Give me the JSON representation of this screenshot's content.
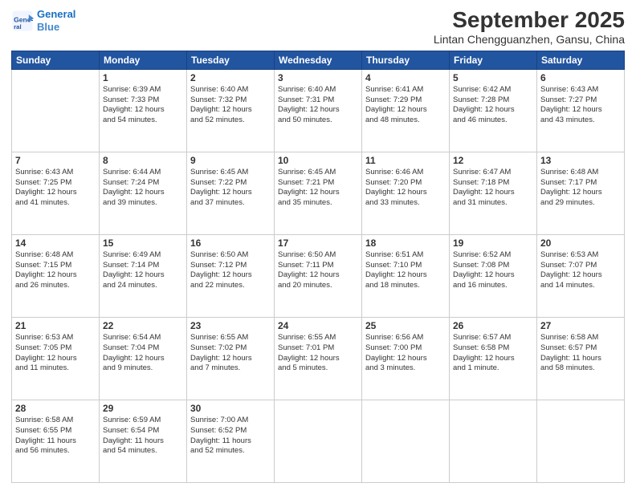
{
  "header": {
    "logo_line1": "General",
    "logo_line2": "Blue",
    "month": "September 2025",
    "location": "Lintan Chengguanzhen, Gansu, China"
  },
  "weekdays": [
    "Sunday",
    "Monday",
    "Tuesday",
    "Wednesday",
    "Thursday",
    "Friday",
    "Saturday"
  ],
  "weeks": [
    [
      {
        "day": "",
        "info": ""
      },
      {
        "day": "1",
        "info": "Sunrise: 6:39 AM\nSunset: 7:33 PM\nDaylight: 12 hours\nand 54 minutes."
      },
      {
        "day": "2",
        "info": "Sunrise: 6:40 AM\nSunset: 7:32 PM\nDaylight: 12 hours\nand 52 minutes."
      },
      {
        "day": "3",
        "info": "Sunrise: 6:40 AM\nSunset: 7:31 PM\nDaylight: 12 hours\nand 50 minutes."
      },
      {
        "day": "4",
        "info": "Sunrise: 6:41 AM\nSunset: 7:29 PM\nDaylight: 12 hours\nand 48 minutes."
      },
      {
        "day": "5",
        "info": "Sunrise: 6:42 AM\nSunset: 7:28 PM\nDaylight: 12 hours\nand 46 minutes."
      },
      {
        "day": "6",
        "info": "Sunrise: 6:43 AM\nSunset: 7:27 PM\nDaylight: 12 hours\nand 43 minutes."
      }
    ],
    [
      {
        "day": "7",
        "info": "Sunrise: 6:43 AM\nSunset: 7:25 PM\nDaylight: 12 hours\nand 41 minutes."
      },
      {
        "day": "8",
        "info": "Sunrise: 6:44 AM\nSunset: 7:24 PM\nDaylight: 12 hours\nand 39 minutes."
      },
      {
        "day": "9",
        "info": "Sunrise: 6:45 AM\nSunset: 7:22 PM\nDaylight: 12 hours\nand 37 minutes."
      },
      {
        "day": "10",
        "info": "Sunrise: 6:45 AM\nSunset: 7:21 PM\nDaylight: 12 hours\nand 35 minutes."
      },
      {
        "day": "11",
        "info": "Sunrise: 6:46 AM\nSunset: 7:20 PM\nDaylight: 12 hours\nand 33 minutes."
      },
      {
        "day": "12",
        "info": "Sunrise: 6:47 AM\nSunset: 7:18 PM\nDaylight: 12 hours\nand 31 minutes."
      },
      {
        "day": "13",
        "info": "Sunrise: 6:48 AM\nSunset: 7:17 PM\nDaylight: 12 hours\nand 29 minutes."
      }
    ],
    [
      {
        "day": "14",
        "info": "Sunrise: 6:48 AM\nSunset: 7:15 PM\nDaylight: 12 hours\nand 26 minutes."
      },
      {
        "day": "15",
        "info": "Sunrise: 6:49 AM\nSunset: 7:14 PM\nDaylight: 12 hours\nand 24 minutes."
      },
      {
        "day": "16",
        "info": "Sunrise: 6:50 AM\nSunset: 7:12 PM\nDaylight: 12 hours\nand 22 minutes."
      },
      {
        "day": "17",
        "info": "Sunrise: 6:50 AM\nSunset: 7:11 PM\nDaylight: 12 hours\nand 20 minutes."
      },
      {
        "day": "18",
        "info": "Sunrise: 6:51 AM\nSunset: 7:10 PM\nDaylight: 12 hours\nand 18 minutes."
      },
      {
        "day": "19",
        "info": "Sunrise: 6:52 AM\nSunset: 7:08 PM\nDaylight: 12 hours\nand 16 minutes."
      },
      {
        "day": "20",
        "info": "Sunrise: 6:53 AM\nSunset: 7:07 PM\nDaylight: 12 hours\nand 14 minutes."
      }
    ],
    [
      {
        "day": "21",
        "info": "Sunrise: 6:53 AM\nSunset: 7:05 PM\nDaylight: 12 hours\nand 11 minutes."
      },
      {
        "day": "22",
        "info": "Sunrise: 6:54 AM\nSunset: 7:04 PM\nDaylight: 12 hours\nand 9 minutes."
      },
      {
        "day": "23",
        "info": "Sunrise: 6:55 AM\nSunset: 7:02 PM\nDaylight: 12 hours\nand 7 minutes."
      },
      {
        "day": "24",
        "info": "Sunrise: 6:55 AM\nSunset: 7:01 PM\nDaylight: 12 hours\nand 5 minutes."
      },
      {
        "day": "25",
        "info": "Sunrise: 6:56 AM\nSunset: 7:00 PM\nDaylight: 12 hours\nand 3 minutes."
      },
      {
        "day": "26",
        "info": "Sunrise: 6:57 AM\nSunset: 6:58 PM\nDaylight: 12 hours\nand 1 minute."
      },
      {
        "day": "27",
        "info": "Sunrise: 6:58 AM\nSunset: 6:57 PM\nDaylight: 11 hours\nand 58 minutes."
      }
    ],
    [
      {
        "day": "28",
        "info": "Sunrise: 6:58 AM\nSunset: 6:55 PM\nDaylight: 11 hours\nand 56 minutes."
      },
      {
        "day": "29",
        "info": "Sunrise: 6:59 AM\nSunset: 6:54 PM\nDaylight: 11 hours\nand 54 minutes."
      },
      {
        "day": "30",
        "info": "Sunrise: 7:00 AM\nSunset: 6:52 PM\nDaylight: 11 hours\nand 52 minutes."
      },
      {
        "day": "",
        "info": ""
      },
      {
        "day": "",
        "info": ""
      },
      {
        "day": "",
        "info": ""
      },
      {
        "day": "",
        "info": ""
      }
    ]
  ]
}
